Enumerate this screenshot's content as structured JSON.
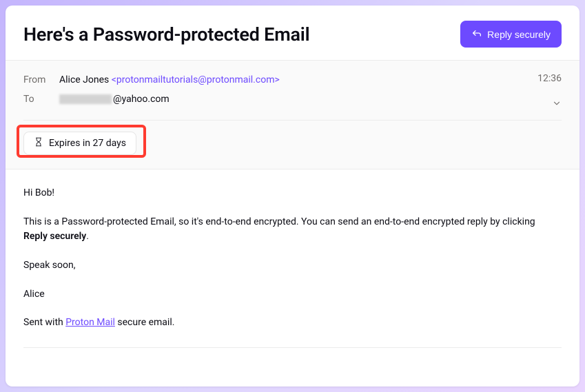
{
  "subject": "Here's a Password-protected Email",
  "reply_button": "Reply securely",
  "meta": {
    "from_label": "From",
    "from_name": "Alice Jones",
    "from_email": "<protonmailtutorials@protonmail.com>",
    "to_label": "To",
    "to_domain": "@yahoo.com",
    "timestamp": "12:36"
  },
  "expiry": {
    "text": "Expires in 27 days"
  },
  "body": {
    "greeting": "Hi Bob!",
    "p1_a": "This is a Password-protected Email, so it's end-to-end encrypted. You can send an end-to-end encrypted reply by clicking ",
    "p1_strong": "Reply securely",
    "p1_b": ".",
    "closing": "Speak soon,",
    "signature": "Alice",
    "sent_prefix": "Sent with ",
    "sent_link": "Proton Mail",
    "sent_suffix": " secure email."
  }
}
